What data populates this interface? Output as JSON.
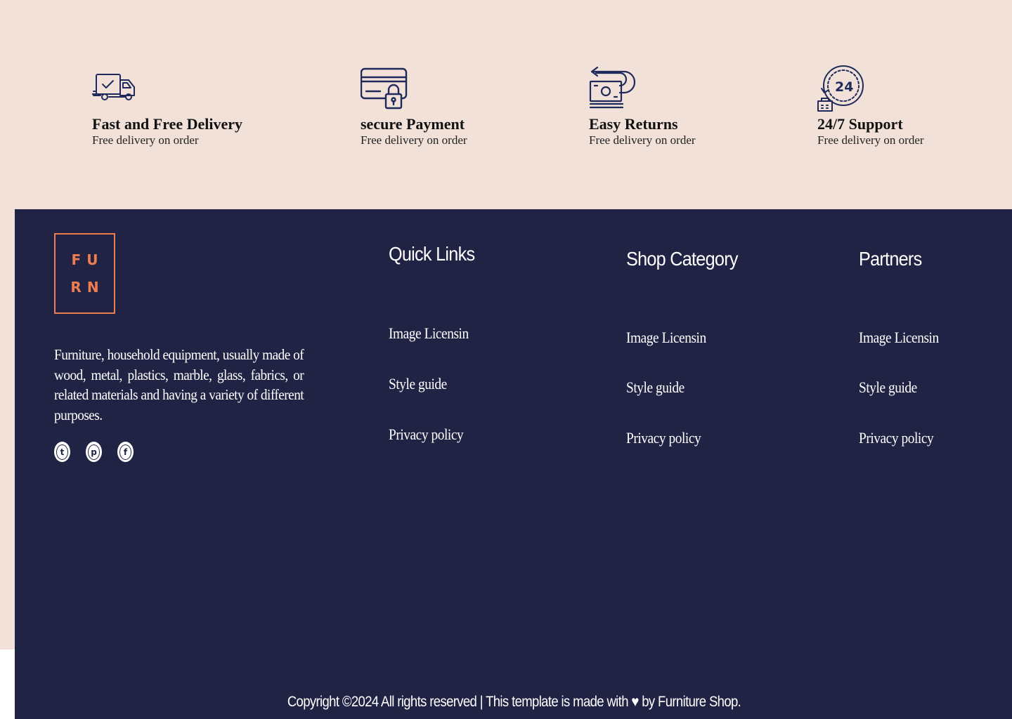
{
  "features": [
    {
      "icon": "delivery-truck-icon",
      "title": "Fast and Free Delivery",
      "subtitle": "Free delivery on order"
    },
    {
      "icon": "secure-card-icon",
      "title": "secure Payment",
      "subtitle": "Free delivery on order"
    },
    {
      "icon": "money-return-icon",
      "title": "Easy Returns",
      "subtitle": "Free delivery on order"
    },
    {
      "icon": "support-24-icon",
      "title": "24/7 Support",
      "subtitle": "Free delivery on order"
    }
  ],
  "footer": {
    "logo": {
      "line1": "FU",
      "line2": "RN"
    },
    "about": "Furniture, household equipment, usually made of wood, metal, plastics, marble, glass, fabrics, or related materials and having a variety of different purposes.",
    "socials": [
      {
        "icon": "twitter-icon",
        "glyph": "t"
      },
      {
        "icon": "pinterest-icon",
        "glyph": "p"
      },
      {
        "icon": "facebook-icon",
        "glyph": "f"
      }
    ],
    "columns": [
      {
        "title": "Quick Links",
        "links": [
          "Image Licensin",
          "Style guide",
          "Privacy policy"
        ]
      },
      {
        "title": "Shop Category",
        "links": [
          "Image Licensin",
          "Style guide",
          "Privacy policy"
        ]
      },
      {
        "title": "Partners",
        "links": [
          "Image Licensin",
          "Style guide",
          "Privacy policy"
        ]
      }
    ],
    "copyright": "Copyright ©2024 All rights reserved | This template is made with ♥ by Furniture Shop."
  },
  "colors": {
    "cream": "#f1e1d9",
    "navy": "#212345",
    "accent": "#ef7d52"
  }
}
